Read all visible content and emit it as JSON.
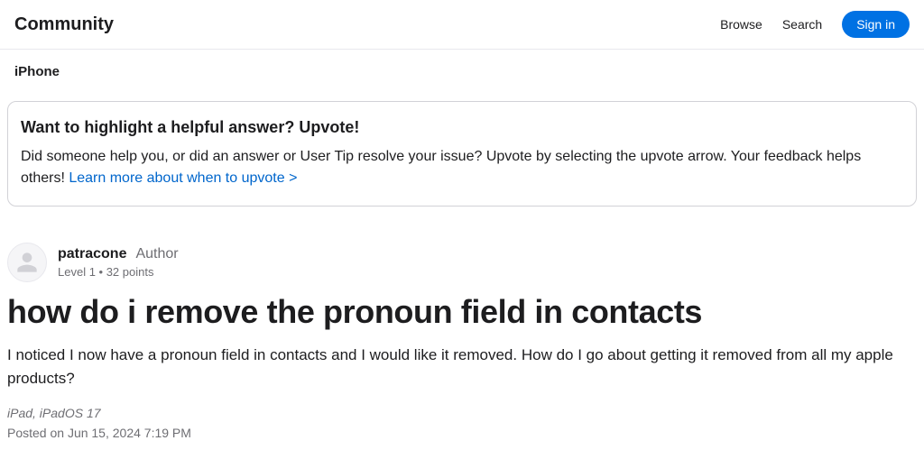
{
  "header": {
    "title": "Community",
    "nav": {
      "browse": "Browse",
      "search": "Search"
    },
    "signin": "Sign in"
  },
  "breadcrumb": {
    "item": "iPhone"
  },
  "infobox": {
    "title": "Want to highlight a helpful answer? Upvote!",
    "text": "Did someone help you, or did an answer or User Tip resolve your issue? Upvote by selecting the upvote arrow. Your feedback helps others! ",
    "link": "Learn more about when to upvote >"
  },
  "post": {
    "author": {
      "name": "patracone",
      "badge": "Author",
      "meta": "Level 1  •  32 points"
    },
    "title": "how do i remove the pronoun field in contacts",
    "body": "I noticed I now have a pronoun field in contacts and I would like it removed. How do I go about getting it removed from all my apple products?",
    "device": "iPad, iPadOS 17",
    "posted": "Posted on Jun 15, 2024 7:19 PM"
  }
}
